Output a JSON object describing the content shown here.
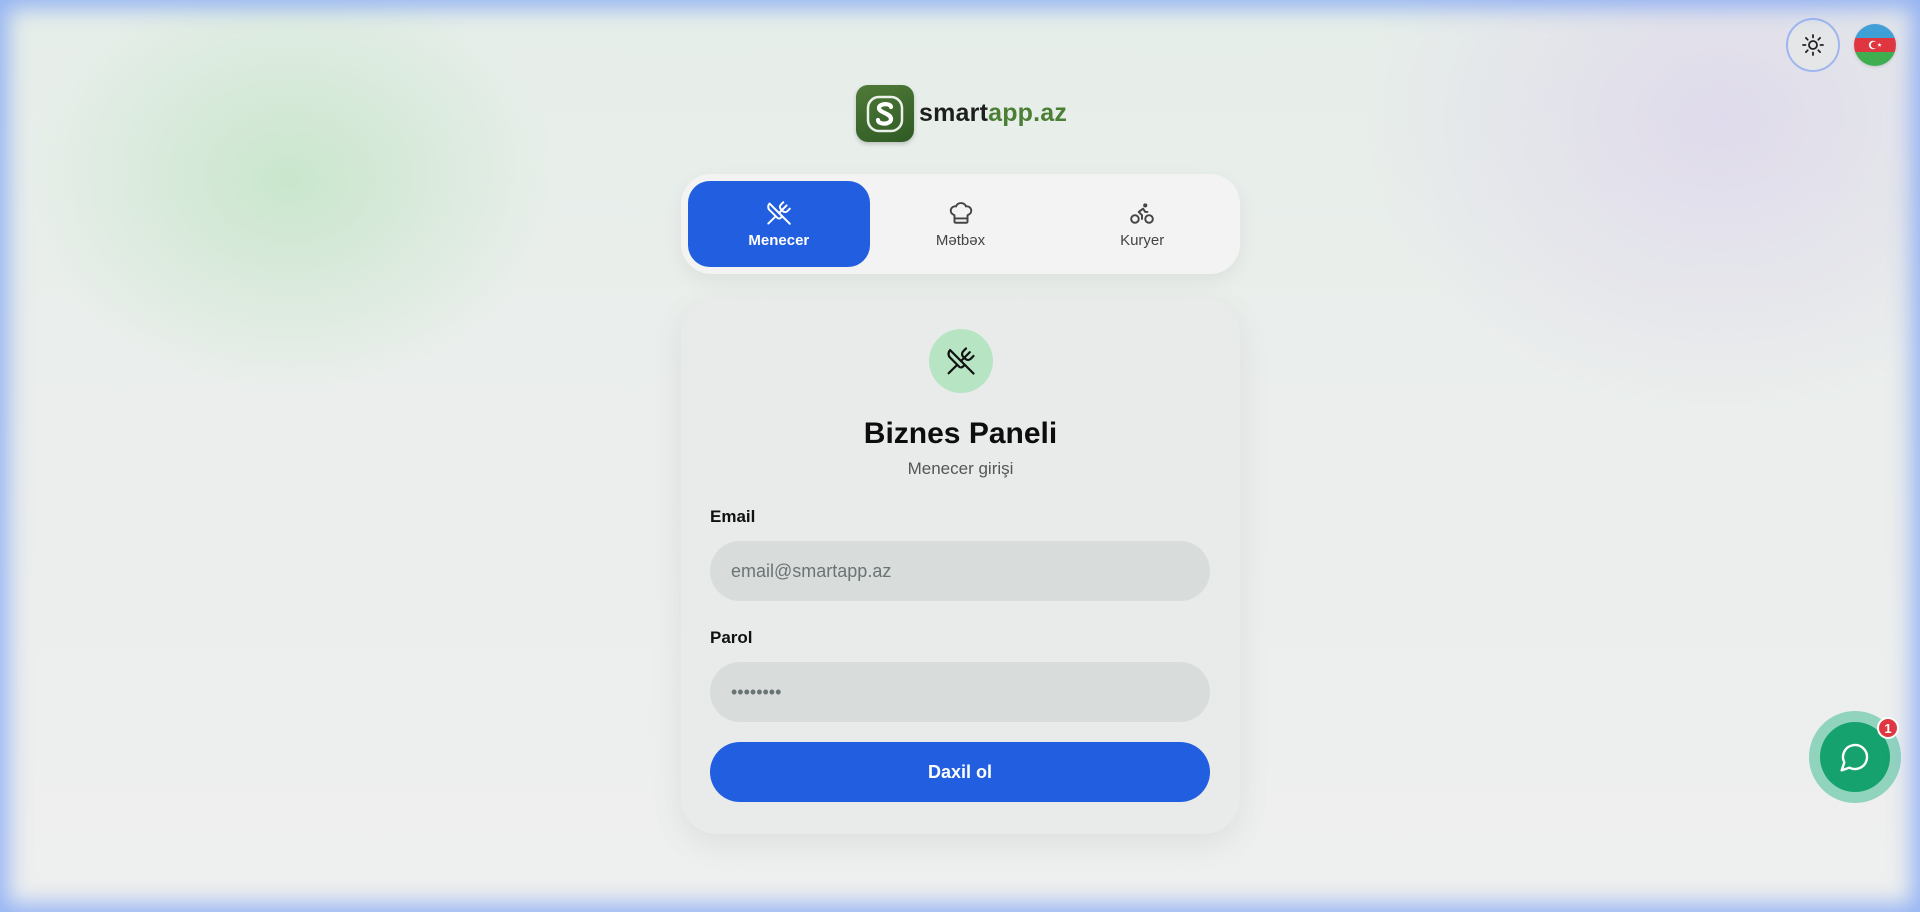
{
  "header": {
    "theme_toggle_icon": "sun-icon",
    "language_flag": "azerbaijan-flag-icon"
  },
  "logo": {
    "icon": "s-logo-icon",
    "text_part1": "smart",
    "text_part2": "app.az"
  },
  "role_tabs": [
    {
      "label": "Menecer",
      "icon": "utensils-crossed-icon",
      "active": true
    },
    {
      "label": "Mətbəx",
      "icon": "chef-hat-icon",
      "active": false
    },
    {
      "label": "Kuryer",
      "icon": "bicycle-icon",
      "active": false
    }
  ],
  "login_card": {
    "role_icon": "utensils-crossed-icon",
    "title": "Biznes Paneli",
    "subtitle": "Menecer girişi",
    "email_label": "Email",
    "email_placeholder": "email@smartapp.az",
    "password_label": "Parol",
    "password_placeholder": "••••••••",
    "submit_label": "Daxil ol"
  },
  "chat": {
    "icon": "chat-bubble-icon",
    "badge_count": "1"
  },
  "colors": {
    "primary": "#225ee0",
    "brand_green": "#4b7f35",
    "role_icon_bg": "#b7e5c4",
    "chat_green": "#16a26e",
    "badge_red": "#e0363f"
  }
}
